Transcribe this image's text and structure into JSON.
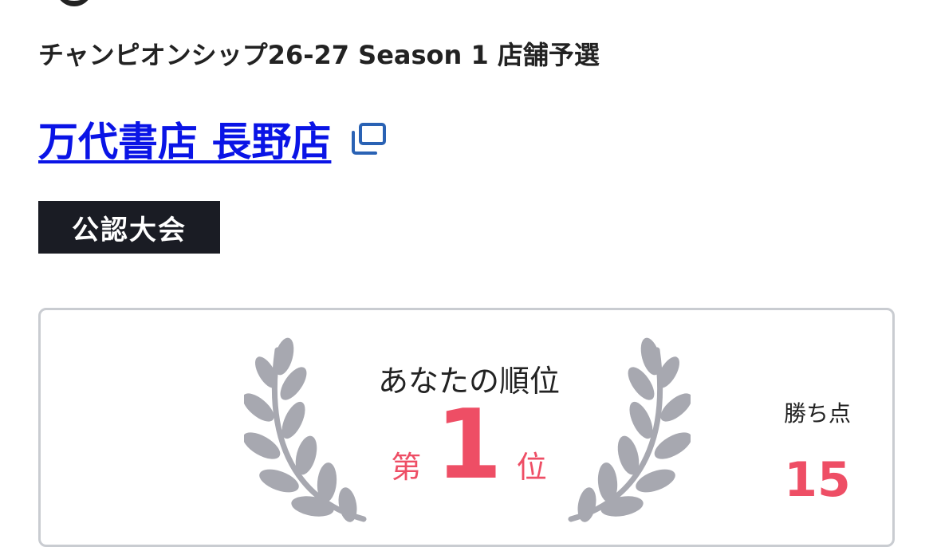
{
  "header": {
    "season_title": "チャンピオンシップ26-27 Season 1 店舗予選",
    "store_name": "万代書店 長野店",
    "badge": "公認大会"
  },
  "result": {
    "rank_label": "あなたの順位",
    "rank_prefix": "第",
    "rank_number": "1",
    "rank_suffix": "位",
    "points_label": "勝ち点",
    "points_value": "15"
  },
  "icons": {
    "external": "external-window-icon",
    "laurel": "laurel-wreath-icon"
  },
  "colors": {
    "link": "#0a14e6",
    "accent": "#ee4e65",
    "badge_bg": "#1a1c24",
    "laurel": "#a7a8b0"
  }
}
